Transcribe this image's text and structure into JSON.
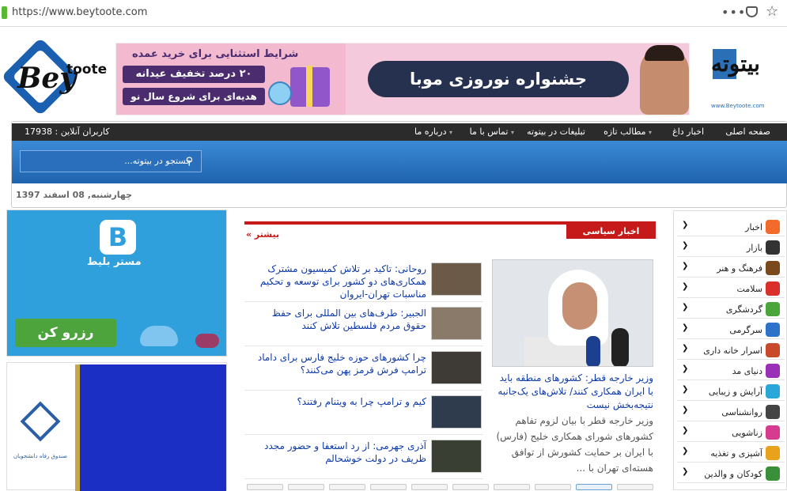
{
  "browser": {
    "url": "https://www.beytoote.com"
  },
  "logo_left": {
    "line1": "Bey",
    "line2": "toote"
  },
  "banner": {
    "line1": "شرایط استثنایی برای خرید عمده",
    "line2": "۲۰ درصد تخفیف عیدانه",
    "line3": "هدیه‌ای برای شروع سال نو",
    "main": "جشنواره نوروزی موبا"
  },
  "logo_right": {
    "text": "بیتوته",
    "url": "www.Beytoote.com"
  },
  "nav": {
    "items": [
      "صفحه اصلی",
      "اخبار داغ",
      "مطالب تازه",
      "تبلیغات در بیتوته",
      "تماس با ما",
      "درباره ما"
    ],
    "online_label": "کاربران آنلاین : 17938"
  },
  "search": {
    "placeholder": "جستجو در بیتوته..."
  },
  "date": "چهارشنبه, 08 اسفند 1397",
  "left_ad": {
    "brand_letter": "B",
    "brand_name": "مستر بلیط",
    "button": "رزرو کن"
  },
  "left_ad2": {
    "caption": "صندوق رفاه دانشجویان"
  },
  "center": {
    "tab": "اخبار سیاسی",
    "more": "بیشتر »",
    "feature": {
      "title": "وزیر خارجه قطر: کشورهای منطقه باید با ایران همکاری کنند/ تلاش‌های یک‌جانبه نتیجه‌بخش نیست",
      "desc": "وزیر خارجه قطر با بیان لزوم تفاهم کشورهای شورای همکاری خلیج (فارس) با ایران بر حمایت کشورش از توافق هسته‌ای تهران با ..."
    },
    "news": [
      "روحانی: تاکید بر تلاش کمیسیون مشترک همکاری‌های دو کشور برای توسعه و تحکیم مناسبات تهران-ایروان",
      "الجبیر: طرف‌های بین المللی برای حفظ حقوق مردم فلسطین تلاش کنند",
      "چرا کشورهای حوزه خلیج فارس برای داماد ترامپ فرش قرمز پهن می‌کنند؟",
      "کیم و ترامپ چرا به ویتنام رفتند؟",
      "آذری جهرمی: از رد استعفا و حضور مجدد ظریف در دولت خوشحالم"
    ]
  },
  "categories": [
    {
      "label": "اخبار",
      "color": "#f26b2a"
    },
    {
      "label": "بازار",
      "color": "#333333"
    },
    {
      "label": "فرهنگ و هنر",
      "color": "#7a4a1e"
    },
    {
      "label": "سلامت",
      "color": "#d9302b"
    },
    {
      "label": "گردشگری",
      "color": "#4aa63a"
    },
    {
      "label": "سرگرمی",
      "color": "#2f72c9"
    },
    {
      "label": "اسرار خانه داری",
      "color": "#c94a2a"
    },
    {
      "label": "دنیای مد",
      "color": "#9a2fb8"
    },
    {
      "label": "آرایش و زیبایی",
      "color": "#2aa7d9"
    },
    {
      "label": "روانشناسی",
      "color": "#444444"
    },
    {
      "label": "زناشویی",
      "color": "#d63b8f"
    },
    {
      "label": "آشپزی و تغذیه",
      "color": "#e8a21c"
    },
    {
      "label": "کودکان و والدین",
      "color": "#3a8f3a"
    }
  ]
}
